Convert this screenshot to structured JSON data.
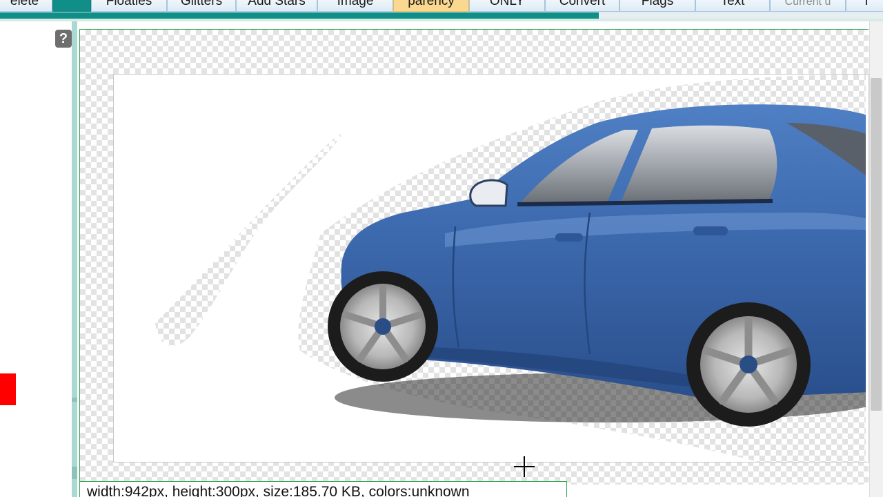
{
  "tabs": [
    {
      "label": "elete",
      "state": "normal"
    },
    {
      "label": "",
      "state": "active"
    },
    {
      "label": "Floaties",
      "state": "normal"
    },
    {
      "label": "Glitters",
      "state": "normal"
    },
    {
      "label": "Add Stars",
      "state": "normal"
    },
    {
      "label": "Image",
      "state": "normal"
    },
    {
      "label": "parency",
      "state": "highlight"
    },
    {
      "label": "ONLY",
      "state": "normal"
    },
    {
      "label": "Convert",
      "state": "normal"
    },
    {
      "label": "Flags",
      "state": "normal"
    },
    {
      "label": "Text",
      "state": "normal"
    },
    {
      "label": "Current u",
      "state": "dim"
    },
    {
      "label": "I",
      "state": "normal"
    }
  ],
  "help": {
    "label": "?"
  },
  "status": {
    "text": "width:942px, height:300px, size:185.70 KB, colors:unknown"
  },
  "colors": {
    "accent": "#0f8f88",
    "highlight_tab": "#fad88f",
    "frame_border": "#2ea44f",
    "car_body": "#3f6fb6",
    "marker": "#ff0000"
  },
  "icons": {
    "help": "question-icon",
    "cursor": "crosshair-cursor-icon"
  }
}
